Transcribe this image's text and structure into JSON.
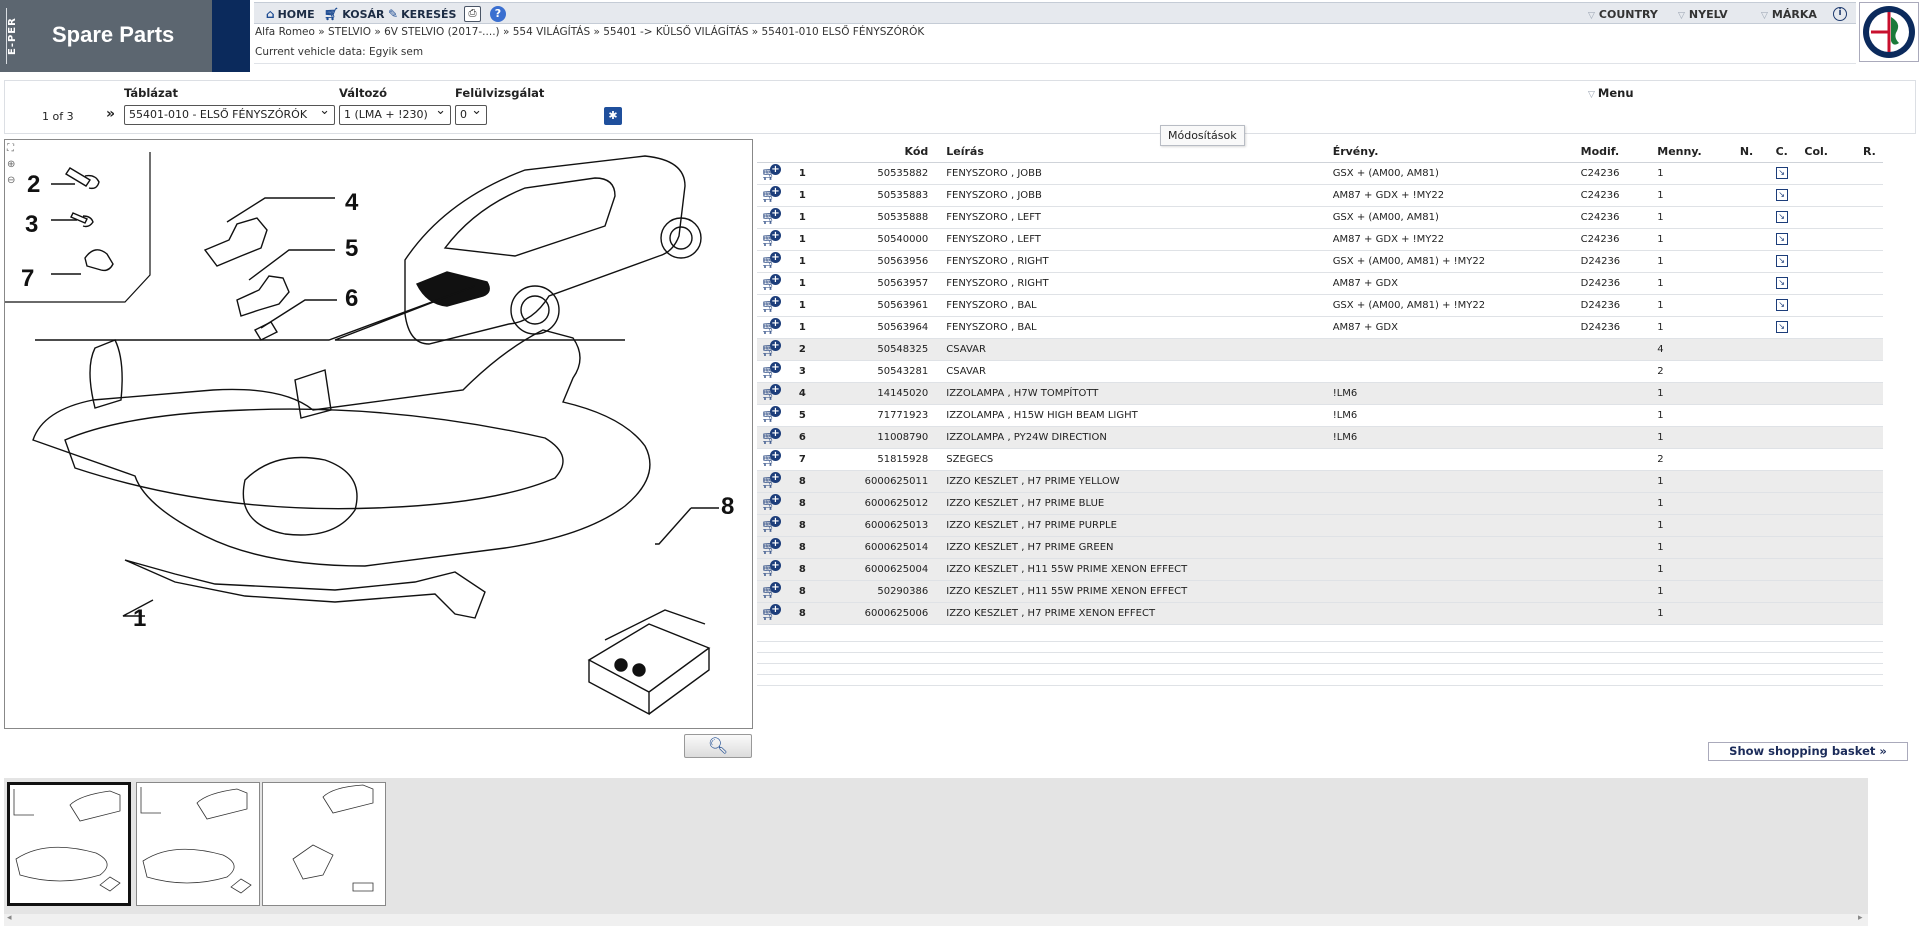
{
  "header": {
    "eper_label": "E-PER",
    "app_title": "Spare Parts",
    "nav": {
      "home": "HOME",
      "basket": "KOSÁR",
      "search": "KERESÉS",
      "help": "?"
    },
    "right_menus": [
      "COUNTRY",
      "NYELV",
      "MÁRKA"
    ],
    "breadcrumb": "Alfa Romeo » STELVIO » 6V STELVIO (2017-....) » 554 VILÁGÍTÁS » 55401 -> KÜLSŐ VILÁGÍTÁS » 55401-010 ELSŐ FÉNYSZÓRÓK",
    "vehicle_data": "Current vehicle data: Egyik sem"
  },
  "filters": {
    "pager": "1 of 3",
    "pager_arrow": "»",
    "table_label": "Táblázat",
    "table_value": "55401-010 - ELSŐ FÉNYSZÓRÓK",
    "variant_label": "Változó",
    "variant_value": "1 (LMA + !230)",
    "review_label": "Felülvizsgálat",
    "review_value": "0",
    "menu": "Menu",
    "tooltip": "Módosítások"
  },
  "drawing": {
    "callouts": [
      "2",
      "3",
      "7",
      "4",
      "5",
      "6",
      "1",
      "8"
    ]
  },
  "table": {
    "headers": {
      "code": "Kód",
      "desc": "Leírás",
      "validity": "Érvény.",
      "modif": "Modif.",
      "qty": "Menny.",
      "n": "N.",
      "c": "C.",
      "col": "Col.",
      "r": "R."
    },
    "rows": [
      {
        "pos": "1",
        "code": "50535882",
        "desc": "FENYSZORO , JOBB",
        "validity": "GSX + (AM00, AM81)",
        "modif": "C24236",
        "qty": "1",
        "note": true,
        "grey": false
      },
      {
        "pos": "1",
        "code": "50535883",
        "desc": "FENYSZORO , JOBB",
        "validity": "AM87 + GDX + !MY22",
        "modif": "C24236",
        "qty": "1",
        "note": true,
        "grey": false
      },
      {
        "pos": "1",
        "code": "50535888",
        "desc": "FENYSZORO , LEFT",
        "validity": "GSX + (AM00, AM81)",
        "modif": "C24236",
        "qty": "1",
        "note": true,
        "grey": false
      },
      {
        "pos": "1",
        "code": "50540000",
        "desc": "FENYSZORO , LEFT",
        "validity": "AM87 + GDX + !MY22",
        "modif": "C24236",
        "qty": "1",
        "note": true,
        "grey": false
      },
      {
        "pos": "1",
        "code": "50563956",
        "desc": "FENYSZORO , RIGHT",
        "validity": "GSX + (AM00, AM81) + !MY22",
        "modif": "D24236",
        "qty": "1",
        "note": true,
        "grey": false
      },
      {
        "pos": "1",
        "code": "50563957",
        "desc": "FENYSZORO , RIGHT",
        "validity": "AM87 + GDX",
        "modif": "D24236",
        "qty": "1",
        "note": true,
        "grey": false
      },
      {
        "pos": "1",
        "code": "50563961",
        "desc": "FENYSZORO , BAL",
        "validity": "GSX + (AM00, AM81) + !MY22",
        "modif": "D24236",
        "qty": "1",
        "note": true,
        "grey": false
      },
      {
        "pos": "1",
        "code": "50563964",
        "desc": "FENYSZORO , BAL",
        "validity": "AM87 + GDX",
        "modif": "D24236",
        "qty": "1",
        "note": true,
        "grey": false
      },
      {
        "pos": "2",
        "code": "50548325",
        "desc": "CSAVAR",
        "validity": "",
        "modif": "",
        "qty": "4",
        "note": false,
        "grey": true
      },
      {
        "pos": "3",
        "code": "50543281",
        "desc": "CSAVAR",
        "validity": "",
        "modif": "",
        "qty": "2",
        "note": false,
        "grey": false
      },
      {
        "pos": "4",
        "code": "14145020",
        "desc": "IZZOLAMPA , H7W TOMPÍTOTT",
        "validity": "!LM6",
        "modif": "",
        "qty": "1",
        "note": false,
        "grey": true
      },
      {
        "pos": "5",
        "code": "71771923",
        "desc": "IZZOLAMPA , H15W HIGH BEAM LIGHT",
        "validity": "!LM6",
        "modif": "",
        "qty": "1",
        "note": false,
        "grey": false
      },
      {
        "pos": "6",
        "code": "11008790",
        "desc": "IZZOLAMPA , PY24W DIRECTION",
        "validity": "!LM6",
        "modif": "",
        "qty": "1",
        "note": false,
        "grey": true
      },
      {
        "pos": "7",
        "code": "51815928",
        "desc": "SZEGECS",
        "validity": "",
        "modif": "",
        "qty": "2",
        "note": false,
        "grey": false
      },
      {
        "pos": "8",
        "code": "6000625011",
        "desc": "IZZO KESZLET , H7 PRIME YELLOW",
        "validity": "",
        "modif": "",
        "qty": "1",
        "note": false,
        "grey": true
      },
      {
        "pos": "8",
        "code": "6000625012",
        "desc": "IZZO KESZLET , H7 PRIME BLUE",
        "validity": "",
        "modif": "",
        "qty": "1",
        "note": false,
        "grey": true
      },
      {
        "pos": "8",
        "code": "6000625013",
        "desc": "IZZO KESZLET , H7 PRIME PURPLE",
        "validity": "",
        "modif": "",
        "qty": "1",
        "note": false,
        "grey": true
      },
      {
        "pos": "8",
        "code": "6000625014",
        "desc": "IZZO KESZLET , H7 PRIME GREEN",
        "validity": "",
        "modif": "",
        "qty": "1",
        "note": false,
        "grey": true
      },
      {
        "pos": "8",
        "code": "6000625004",
        "desc": "IZZO KESZLET , H11 55W PRIME XENON EFFECT",
        "validity": "",
        "modif": "",
        "qty": "1",
        "note": false,
        "grey": true
      },
      {
        "pos": "8",
        "code": "50290386",
        "desc": "IZZO KESZLET , H11 55W PRIME XENON EFFECT",
        "validity": "",
        "modif": "",
        "qty": "1",
        "note": false,
        "grey": true
      },
      {
        "pos": "8",
        "code": "6000625006",
        "desc": "IZZO KESZLET , H7 PRIME XENON EFFECT",
        "validity": "",
        "modif": "",
        "qty": "1",
        "note": false,
        "grey": true
      }
    ]
  },
  "basket_button": "Show shopping basket »",
  "colors": {
    "navy": "#0b2a5c",
    "logo_grey": "#5c6670",
    "icon_blue": "#1c3d7a",
    "row_grey": "#ececec"
  }
}
